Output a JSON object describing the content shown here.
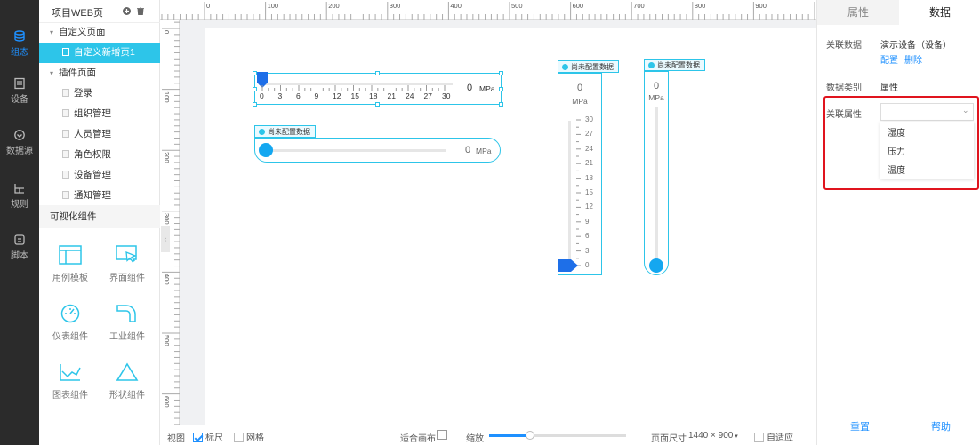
{
  "nav": {
    "items": [
      {
        "label": "组态",
        "icon": "layers-icon",
        "active": true
      },
      {
        "label": "设备",
        "icon": "device-icon",
        "active": false
      },
      {
        "label": "数据源",
        "icon": "data-source-icon",
        "active": false
      },
      {
        "label": "规则",
        "icon": "rule-icon",
        "active": false
      },
      {
        "label": "脚本",
        "icon": "script-icon",
        "active": false
      }
    ]
  },
  "sidebar": {
    "project_title": "项目WEB页",
    "custom_group": "自定义页面",
    "custom_pages": [
      "自定义新增页1"
    ],
    "plugin_group": "插件页面",
    "plugin_pages": [
      "登录",
      "组织管理",
      "人员管理",
      "角色权限",
      "设备管理",
      "通知管理"
    ],
    "components_title": "可视化组件",
    "components": [
      {
        "label": "用例模板",
        "icon": "template-icon"
      },
      {
        "label": "界面组件",
        "icon": "ui-component-icon"
      },
      {
        "label": "仪表组件",
        "icon": "gauge-icon"
      },
      {
        "label": "工业组件",
        "icon": "pipe-icon"
      },
      {
        "label": "图表组件",
        "icon": "chart-icon"
      },
      {
        "label": "形状组件",
        "icon": "triangle-icon"
      }
    ]
  },
  "ruler": {
    "top_labels": [
      "0",
      "100",
      "200",
      "300",
      "400",
      "500",
      "600",
      "700",
      "800",
      "900"
    ],
    "left_labels": [
      "0",
      "100",
      "200",
      "300",
      "400",
      "500",
      "600"
    ]
  },
  "widgets": {
    "unconfigured_tag": "尚未配置数据",
    "gauge1": {
      "value": "0",
      "unit": "MPa",
      "scale": [
        "0",
        "3",
        "6",
        "9",
        "12",
        "15",
        "18",
        "21",
        "24",
        "27",
        "30"
      ]
    },
    "slider1": {
      "value": "0",
      "unit": "MPa"
    },
    "vgauge": {
      "value": "0",
      "unit": "MPa",
      "scale": [
        "30",
        "27",
        "24",
        "21",
        "18",
        "15",
        "12",
        "9",
        "6",
        "3",
        "0"
      ]
    },
    "vslider": {
      "value": "0",
      "unit": "MPa"
    }
  },
  "bottombar": {
    "view_label": "视图",
    "ruler_label": "标尺",
    "ruler_checked": true,
    "grid_label": "网格",
    "grid_checked": false,
    "fit_canvas_label": "适合画布",
    "zoom_label": "缩放",
    "zoom_level": 0.3,
    "page_size_label": "页面尺寸",
    "page_size_value": "1440 × 900",
    "auto_fit_label": "自适应"
  },
  "rpanel": {
    "tabs": [
      "属性",
      "数据"
    ],
    "active_tab": "数据",
    "linked_data_label": "关联数据",
    "linked_data_value": "演示设备（设备）",
    "configure_link": "配置",
    "delete_link": "删除",
    "data_type_label": "数据类别",
    "data_type_value": "属性",
    "linked_prop_label": "关联属性",
    "linked_prop_value": "",
    "options": [
      "湿度",
      "压力",
      "温度"
    ],
    "reset_button": "重置",
    "help_button": "帮助"
  },
  "colors": {
    "accent": "#2dc5e9",
    "link": "#1e90ff",
    "highlight": "#e0141e",
    "nav_bg": "#2b2b2b"
  }
}
